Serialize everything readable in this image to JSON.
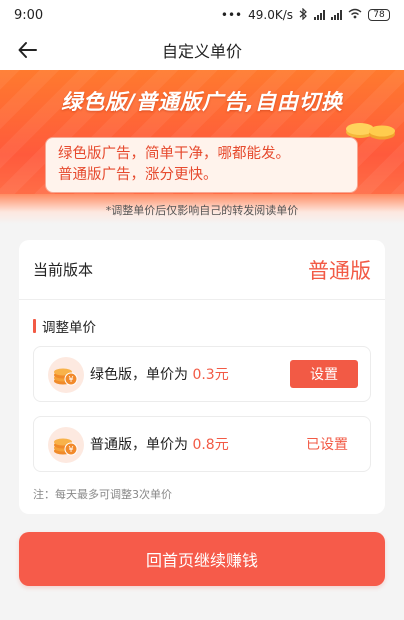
{
  "status_bar": {
    "time": "9:00",
    "network_speed": "49.0K/s",
    "battery": "78",
    "icons": [
      "dots-icon",
      "bluetooth-icon",
      "signal-icon",
      "signal-icon",
      "wifi-icon",
      "battery-icon"
    ]
  },
  "nav": {
    "title": "自定义单价",
    "back_icon": "back-arrow-icon"
  },
  "banner": {
    "headline": "绿色版/普通版广告,自由切换",
    "line1": "绿色版广告，简单干净，哪都能发。",
    "line2": "普通版广告，涨分更快。",
    "note": "*调整单价后仅影响自己的转发阅读单价"
  },
  "current_version": {
    "label": "当前版本",
    "value": "普通版"
  },
  "adjust": {
    "title": "调整单价",
    "options": [
      {
        "name": "绿色版，单价为",
        "price": "0.3元",
        "action": "设置",
        "icon": "coin-stack-icon"
      },
      {
        "name": "普通版，单价为",
        "price": "0.8元",
        "status": "已设置",
        "icon": "coin-stack-icon"
      }
    ],
    "note": "注：每天最多可调整3次单价"
  },
  "cta_label": "回首页继续赚钱",
  "colors": {
    "accent": "#f25a45",
    "banner_top": "#ff7a2e",
    "banner_bottom": "#ff5a3c",
    "page_bg": "#f4f4f4"
  }
}
